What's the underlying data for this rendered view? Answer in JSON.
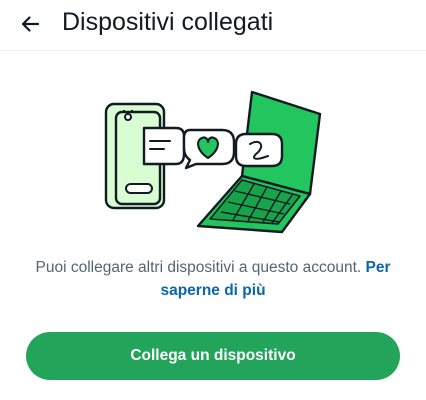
{
  "header": {
    "title": "Dispositivi collegati",
    "back_icon": "arrow-left-icon"
  },
  "illustration": {
    "name": "linked-devices-illustration",
    "icons": [
      "phone-icon",
      "heart-icon",
      "handwriting-icon",
      "laptop-icon"
    ],
    "colors": {
      "accent": "#25D366",
      "light_green": "#D9FDD3",
      "outline": "#111B21"
    }
  },
  "description": {
    "text": "Puoi collegare altri dispositivi a questo account.",
    "link_label": "Per saperne di più"
  },
  "actions": {
    "link_device_label": "Collega un dispositivo"
  },
  "theme": {
    "button_color": "#22A45B",
    "link_color": "#0A66A8",
    "text_secondary": "#54656F"
  }
}
